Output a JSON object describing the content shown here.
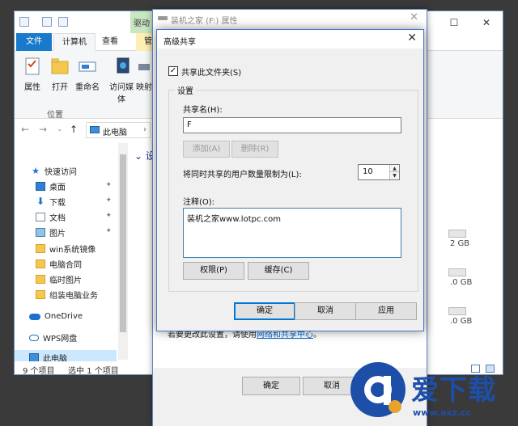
{
  "explorer": {
    "ribbon_tabs": {
      "file": "文件",
      "computer": "计算机",
      "view": "查看",
      "manage": "管",
      "drive_tools": "驱动"
    },
    "ribbon_buttons": [
      {
        "label": "属性",
        "icon": "properties-icon"
      },
      {
        "label": "打开",
        "icon": "open-folder-icon"
      },
      {
        "label": "重命名",
        "icon": "rename-icon"
      },
      {
        "label": "访问媒体",
        "icon": "media-icon"
      },
      {
        "label": "映射",
        "icon": "map-drive-icon"
      }
    ],
    "ribbon_group_label": "位置",
    "address": "此电脑",
    "devices_heading": "设备",
    "nav": {
      "quick_access": "快速访问",
      "items": [
        {
          "label": "桌面",
          "icon": "desktop-icon",
          "pinned": true
        },
        {
          "label": "下载",
          "icon": "download-icon",
          "pinned": true
        },
        {
          "label": "文档",
          "icon": "document-icon",
          "pinned": true
        },
        {
          "label": "图片",
          "icon": "pictures-icon",
          "pinned": true
        },
        {
          "label": "win系统镜像",
          "icon": "folder-icon"
        },
        {
          "label": "电脑合同",
          "icon": "folder-icon"
        },
        {
          "label": "临时图片",
          "icon": "folder-icon"
        },
        {
          "label": "组装电脑业务",
          "icon": "folder-icon"
        }
      ],
      "onedrive": "OneDrive",
      "wps": "WPS网盘",
      "this_pc": "此电脑"
    },
    "sizes": [
      "2 GB",
      ".0 GB",
      ".0 GB"
    ],
    "status": {
      "count": "9 个项目",
      "selected": "选中 1 个项目"
    }
  },
  "properties": {
    "title": "装机之家 (F:) 属性",
    "hint_prefix": "若要更改此设置，请使用",
    "hint_link": "网络和共享中心",
    "hint_suffix": "。",
    "ok": "确定",
    "cancel": "取消"
  },
  "advanced": {
    "title": "高级共享",
    "share_checkbox_label": "共享此文件夹(S)",
    "share_checked": true,
    "settings_label": "设置",
    "share_name_label": "共享名(H):",
    "share_name_value": "F",
    "add": "添加(A)",
    "remove": "删除(R)",
    "user_limit_label": "将同时共享的用户数量限制为(L):",
    "user_limit_value": "10",
    "comment_label": "注释(O):",
    "comment_value": "装机之家www.lotpc.com",
    "permissions": "权限(P)",
    "caching": "缓存(C)",
    "ok": "确定",
    "cancel": "取消",
    "apply": "应用"
  },
  "watermark": {
    "title": "爱下载",
    "url": "www.axz.cc",
    "color": "#1e4fa8"
  }
}
